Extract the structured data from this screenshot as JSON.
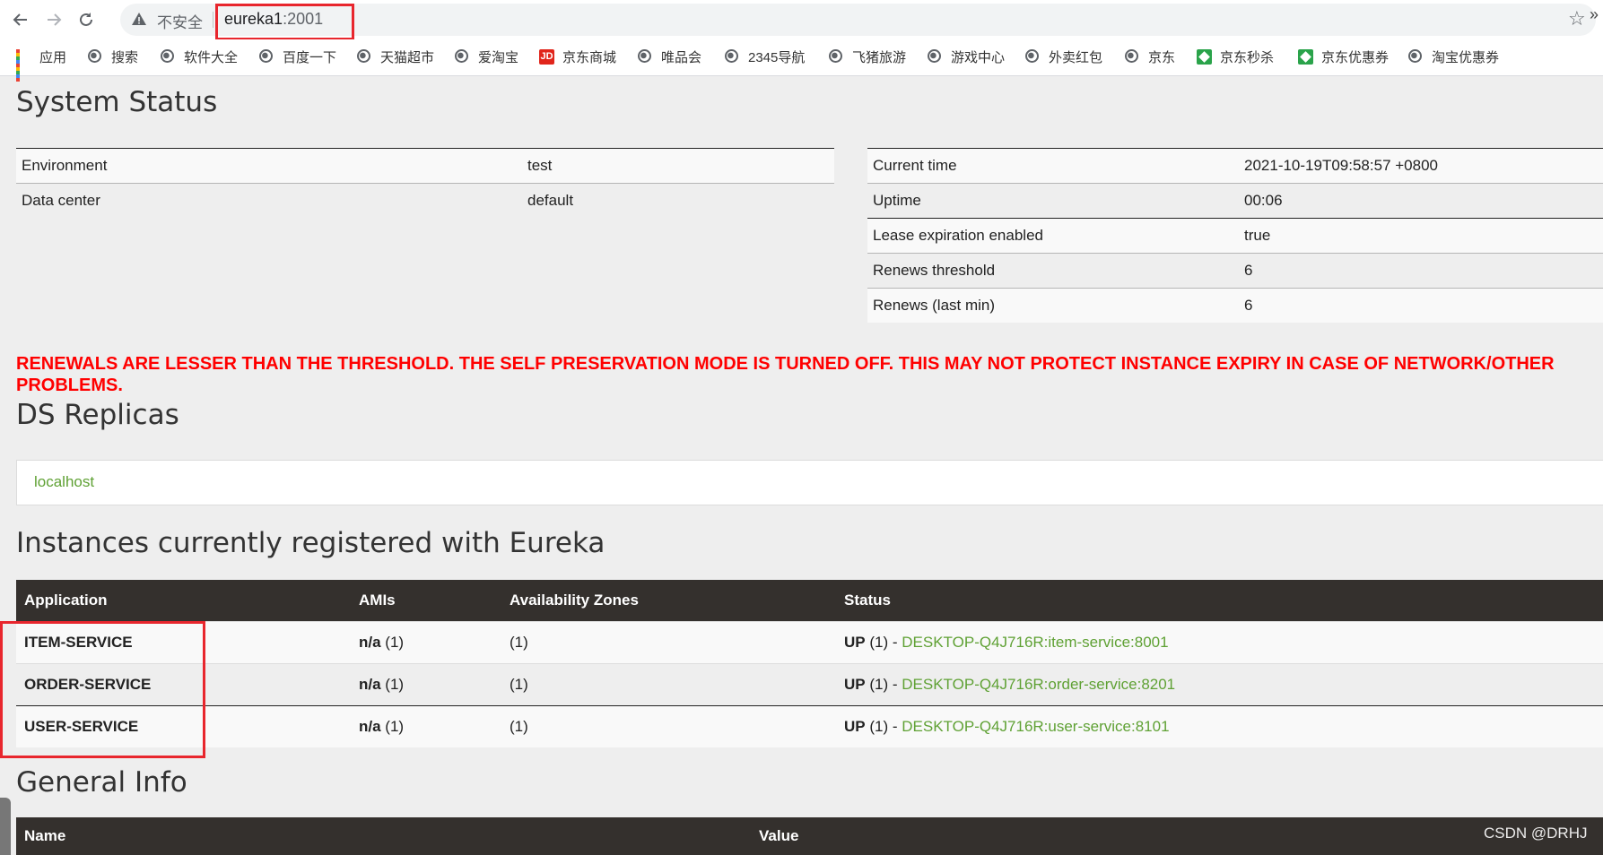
{
  "browser": {
    "security_label": "不安全",
    "url_host": "eureka1",
    "url_port": ":2001",
    "icons": {
      "back": "back-arrow-icon",
      "forward": "forward-arrow-icon",
      "reload": "reload-icon",
      "warning": "warning-triangle-icon",
      "star": "star-icon"
    }
  },
  "bookmarks": [
    {
      "label": "应用",
      "icon": "apps-grid-icon"
    },
    {
      "label": "搜索",
      "icon": "globe-icon"
    },
    {
      "label": "软件大全",
      "icon": "globe-icon"
    },
    {
      "label": "百度一下",
      "icon": "globe-icon"
    },
    {
      "label": "天猫超市",
      "icon": "globe-icon"
    },
    {
      "label": "爱淘宝",
      "icon": "globe-icon"
    },
    {
      "label": "京东商城",
      "icon": "jd-icon"
    },
    {
      "label": "唯品会",
      "icon": "globe-icon"
    },
    {
      "label": "2345导航",
      "icon": "globe-icon"
    },
    {
      "label": "飞猪旅游",
      "icon": "globe-icon"
    },
    {
      "label": "游戏中心",
      "icon": "globe-icon"
    },
    {
      "label": "外卖红包",
      "icon": "globe-icon"
    },
    {
      "label": "京东",
      "icon": "globe-icon"
    },
    {
      "label": "京东秒杀",
      "icon": "jd-green-icon"
    },
    {
      "label": "京东优惠券",
      "icon": "jd-green-icon"
    },
    {
      "label": "淘宝优惠券",
      "icon": "globe-icon"
    }
  ],
  "bookmarks_more": "»",
  "system_status": {
    "title": "System Status",
    "left": [
      {
        "key": "Environment",
        "value": "test"
      },
      {
        "key": "Data center",
        "value": "default"
      }
    ],
    "right": [
      {
        "key": "Current time",
        "value": "2021-10-19T09:58:57 +0800"
      },
      {
        "key": "Uptime",
        "value": "00:06"
      },
      {
        "key": "Lease expiration enabled",
        "value": "true"
      },
      {
        "key": "Renews threshold",
        "value": "6"
      },
      {
        "key": "Renews (last min)",
        "value": "6"
      }
    ]
  },
  "warning": "RENEWALS ARE LESSER THAN THE THRESHOLD. THE SELF PRESERVATION MODE IS TURNED OFF. THIS MAY NOT PROTECT INSTANCE EXPIRY IN CASE OF NETWORK/OTHER PROBLEMS.",
  "replicas": {
    "title": "DS Replicas",
    "link": "localhost"
  },
  "instances": {
    "title": "Instances currently registered with Eureka",
    "headers": [
      "Application",
      "AMIs",
      "Availability Zones",
      "Status"
    ],
    "rows": [
      {
        "app": "ITEM-SERVICE",
        "ami": "n/a",
        "ami_count": "(1)",
        "zones": "(1)",
        "status": "UP",
        "status_count": "(1) -",
        "instance": "DESKTOP-Q4J716R:item-service:8001"
      },
      {
        "app": "ORDER-SERVICE",
        "ami": "n/a",
        "ami_count": "(1)",
        "zones": "(1)",
        "status": "UP",
        "status_count": "(1) -",
        "instance": "DESKTOP-Q4J716R:order-service:8201"
      },
      {
        "app": "USER-SERVICE",
        "ami": "n/a",
        "ami_count": "(1)",
        "zones": "(1)",
        "status": "UP",
        "status_count": "(1) -",
        "instance": "DESKTOP-Q4J716R:user-service:8101"
      }
    ]
  },
  "general_info": {
    "title": "General Info",
    "headers": [
      "Name",
      "Value"
    ]
  },
  "watermark": "CSDN @DRHJ",
  "colors": {
    "accent_green": "#5fa134",
    "warning_red": "#ff0000",
    "table_header": "#34302d",
    "highlight": "#e8262d"
  }
}
